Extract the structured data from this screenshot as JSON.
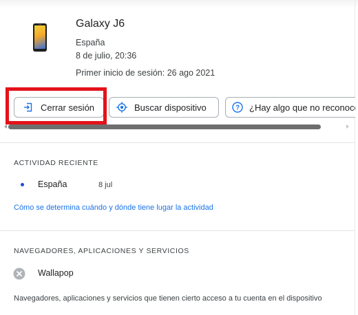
{
  "device": {
    "name": "Galaxy J6",
    "location": "España",
    "last_activity": "8 de julio, 20:36",
    "first_sign_in": "Primer inicio de sesión: 26 ago 2021"
  },
  "actions": {
    "sign_out": "Cerrar sesión",
    "find_device": "Buscar dispositivo",
    "dont_recognize": "¿Hay algo que no reconoces?"
  },
  "recent_activity": {
    "heading": "ACTIVIDAD RECIENTE",
    "items": [
      {
        "location": "España",
        "date": "8 jul"
      }
    ],
    "info_link": "Cómo se determina cuándo y dónde tiene lugar la actividad"
  },
  "apps": {
    "heading": "NAVEGADORES, APLICACIONES Y SERVICIOS",
    "items": [
      {
        "name": "Wallapop",
        "icon": "app-icon"
      }
    ],
    "description": "Navegadores, aplicaciones y servicios que tienen cierto acceso a tu cuenta en el dispositivo"
  },
  "colors": {
    "highlight": "#e4121a",
    "link": "#1a73e8",
    "dot": "#1a4fd6"
  }
}
